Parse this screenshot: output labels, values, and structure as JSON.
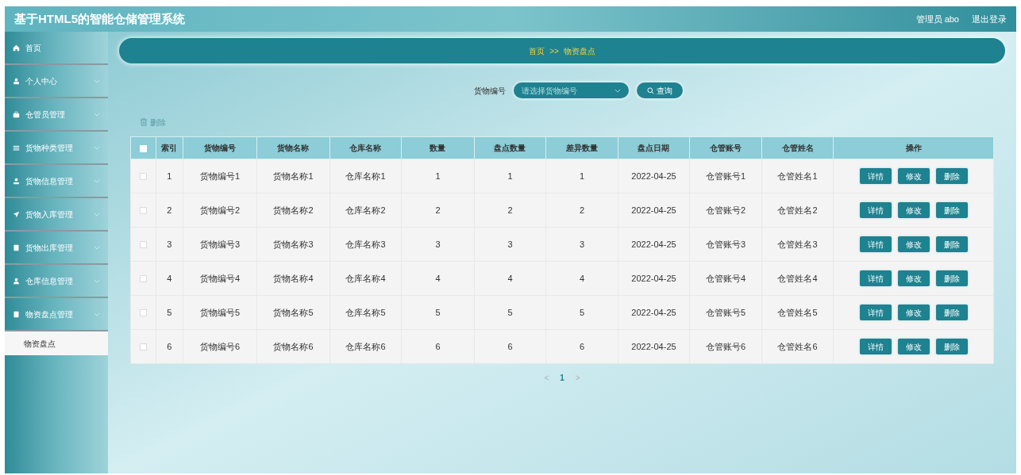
{
  "header": {
    "title": "基于HTML5的智能仓储管理系统",
    "user": "管理员 abo",
    "logout": "退出登录"
  },
  "sidebar": {
    "items": [
      {
        "label": "首页",
        "kind": "link"
      },
      {
        "label": "个人中心",
        "kind": "menu"
      },
      {
        "label": "仓管员管理",
        "kind": "menu"
      },
      {
        "label": "货物种类管理",
        "kind": "menu"
      },
      {
        "label": "货物信息管理",
        "kind": "menu"
      },
      {
        "label": "货物入库管理",
        "kind": "menu"
      },
      {
        "label": "货物出库管理",
        "kind": "menu"
      },
      {
        "label": "仓库信息管理",
        "kind": "menu"
      },
      {
        "label": "物资盘点管理",
        "kind": "menu",
        "children": [
          {
            "label": "物资盘点",
            "selected": true
          }
        ]
      }
    ]
  },
  "breadcrumb": [
    "首页",
    ">>",
    "物资盘点"
  ],
  "search": {
    "label": "货物编号",
    "placeholder": "请选择货物编号",
    "button": "查询"
  },
  "bulk_delete": "删除",
  "table": {
    "columns": [
      "索引",
      "货物编号",
      "货物名称",
      "仓库名称",
      "数量",
      "盘点数量",
      "差异数量",
      "盘点日期",
      "仓管账号",
      "仓管姓名",
      "操作"
    ],
    "header_checked": false,
    "rows": [
      {
        "checked": false,
        "cells": [
          "1",
          "货物编号1",
          "货物名称1",
          "仓库名称1",
          "1",
          "1",
          "1",
          "2022-04-25",
          "仓管账号1",
          "仓管姓名1"
        ],
        "actions": [
          "详情",
          "修改",
          "删除"
        ]
      },
      {
        "checked": false,
        "cells": [
          "2",
          "货物编号2",
          "货物名称2",
          "仓库名称2",
          "2",
          "2",
          "2",
          "2022-04-25",
          "仓管账号2",
          "仓管姓名2"
        ],
        "actions": [
          "详情",
          "修改",
          "删除"
        ]
      },
      {
        "checked": false,
        "cells": [
          "3",
          "货物编号3",
          "货物名称3",
          "仓库名称3",
          "3",
          "3",
          "3",
          "2022-04-25",
          "仓管账号3",
          "仓管姓名3"
        ],
        "actions": [
          "详情",
          "修改",
          "删除"
        ]
      },
      {
        "checked": false,
        "cells": [
          "4",
          "货物编号4",
          "货物名称4",
          "仓库名称4",
          "4",
          "4",
          "4",
          "2022-04-25",
          "仓管账号4",
          "仓管姓名4"
        ],
        "actions": [
          "详情",
          "修改",
          "删除"
        ]
      },
      {
        "checked": false,
        "cells": [
          "5",
          "货物编号5",
          "货物名称5",
          "仓库名称5",
          "5",
          "5",
          "5",
          "2022-04-25",
          "仓管账号5",
          "仓管姓名5"
        ],
        "actions": [
          "详情",
          "修改",
          "删除"
        ]
      },
      {
        "checked": false,
        "cells": [
          "6",
          "货物编号6",
          "货物名称6",
          "仓库名称6",
          "6",
          "6",
          "6",
          "2022-04-25",
          "仓管账号6",
          "仓管姓名6"
        ],
        "actions": [
          "详情",
          "修改",
          "删除"
        ]
      }
    ]
  },
  "pagination": {
    "prev": "<",
    "next": ">",
    "pages": [
      {
        "label": "1",
        "selected": true
      }
    ]
  }
}
